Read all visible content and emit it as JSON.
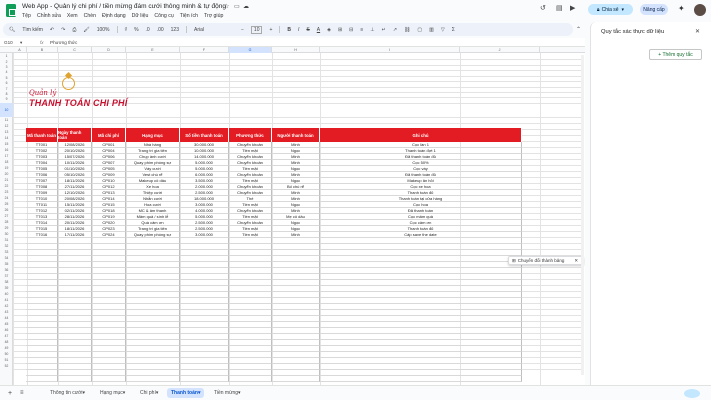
{
  "app": {
    "title": "Web App - Quản lý chi phí / tiền mừng đám cưới thông minh & tự động",
    "menus": [
      "Tệp",
      "Chỉnh sửa",
      "Xem",
      "Chèn",
      "Định dạng",
      "Dữ liệu",
      "Công cụ",
      "Tiện ích",
      "Trợ giúp"
    ],
    "share_label": "Chia sẻ",
    "upgrade_label": "Nâng cấp"
  },
  "toolbar": {
    "search_label": "Tìm kiếm",
    "zoom": "100%",
    "currency": "₫",
    "percent": "%",
    "decimal1": ".0",
    "decimal2": ".00",
    "number_format": "123",
    "font": "Arial",
    "font_size": "10"
  },
  "formula_bar": {
    "cell_ref": "G10",
    "fx": "fx",
    "value": "Phương thức"
  },
  "columns": [
    "A",
    "B",
    "C",
    "D",
    "E",
    "F",
    "G",
    "H",
    "I",
    "J"
  ],
  "selected_column": "G",
  "selected_row": "10",
  "brand": {
    "top": "Quản lý",
    "main": "THANH TOÁN CHI PHÍ"
  },
  "table": {
    "headers": [
      "Mã thanh toán",
      "Ngày thanh toán",
      "Mã chi phí",
      "Hạng mục",
      "Số tiền thanh toán",
      "Phương thức",
      "Người thanh toán",
      "Ghi chú"
    ],
    "rows": [
      [
        "TT001",
        "12/08/2026",
        "CP001",
        "Nhà hàng",
        "30.000.000",
        "Chuyển khoản",
        "Minh",
        "Cọc lần 1"
      ],
      [
        "TT002",
        "20/10/2026",
        "CP004",
        "Trang trí gia tiên",
        "10.000.000",
        "Tiền mặt",
        "Ngọc",
        "Thanh toán đợt 1"
      ],
      [
        "TT003",
        "15/07/2026",
        "CP006",
        "Chụp ảnh cưới",
        "14.000.000",
        "Chuyển khoản",
        "Minh",
        "Đã thanh toán đủ"
      ],
      [
        "TT004",
        "10/11/2026",
        "CP007",
        "Quay phim phóng sự",
        "5.000.000",
        "Chuyển khoản",
        "Minh",
        "Cọc 50%"
      ],
      [
        "TT005",
        "01/10/2026",
        "CP005",
        "Váy cưới",
        "5.000.000",
        "Tiền mặt",
        "Ngọc",
        "Cọc váy"
      ],
      [
        "TT006",
        "05/10/2026",
        "CP009",
        "Vest chú rể",
        "6.000.000",
        "Chuyển khoản",
        "Minh",
        "Đã thanh toán đủ"
      ],
      [
        "TT007",
        "18/11/2026",
        "CP010",
        "Makeup cô dâu",
        "3.500.000",
        "Tiền mặt",
        "Ngọc",
        "Makeup ăn hỏi"
      ],
      [
        "TT008",
        "27/11/2026",
        "CP012",
        "Xe hoa",
        "2.000.000",
        "Chuyển khoản",
        "Bố chú rể",
        "Cọc xe hoa"
      ],
      [
        "TT009",
        "12/10/2026",
        "CP013",
        "Thiệp cưới",
        "2.500.000",
        "Chuyển khoản",
        "Minh",
        "Thanh toán đủ"
      ],
      [
        "TT010",
        "20/08/2026",
        "CP014",
        "Nhẫn cưới",
        "18.000.000",
        "Thẻ",
        "Minh",
        "Thanh toán tại cửa hàng"
      ],
      [
        "TT011",
        "15/11/2026",
        "CP015",
        "Hoa cưới",
        "3.000.000",
        "Tiền mặt",
        "Ngọc",
        "Cọc hoa"
      ],
      [
        "TT012",
        "02/11/2026",
        "CP018",
        "MC & âm thanh",
        "4.000.000",
        "Chuyển khoản",
        "Minh",
        "Đã thanh toán"
      ],
      [
        "TT013",
        "28/11/2026",
        "CP019",
        "Mâm quả / sính lễ",
        "5.000.000",
        "Tiền mặt",
        "Mẹ cô dâu",
        "Cọc mâm quả"
      ],
      [
        "TT014",
        "20/11/2026",
        "CP020",
        "Quà cảm ơn",
        "2.500.000",
        "Chuyển khoản",
        "Ngọc",
        "Cọc cảm ơn"
      ],
      [
        "TT015",
        "18/11/2026",
        "CP023",
        "Trang trí gia tiên",
        "2.500.000",
        "Tiền mặt",
        "Ngọc",
        "Thanh toán đủ"
      ],
      [
        "TT016",
        "17/11/2026",
        "CP024",
        "Quay phim phóng sự",
        "3.000.000",
        "Tiền mặt",
        "Minh",
        "Cấp save the date"
      ]
    ]
  },
  "chip": {
    "label": "Chuyển đổi thành bảng"
  },
  "panel": {
    "title": "Quy tắc xác thực dữ liệu",
    "add_rule": "+ Thêm quy tắc"
  },
  "sheets": {
    "add": "+",
    "list": "≡",
    "tabs": [
      "Thông tin cưới",
      "Hạng mục",
      "Chi phí",
      "Thanh toán",
      "Tiền mừng"
    ],
    "active": "Thanh toán"
  }
}
